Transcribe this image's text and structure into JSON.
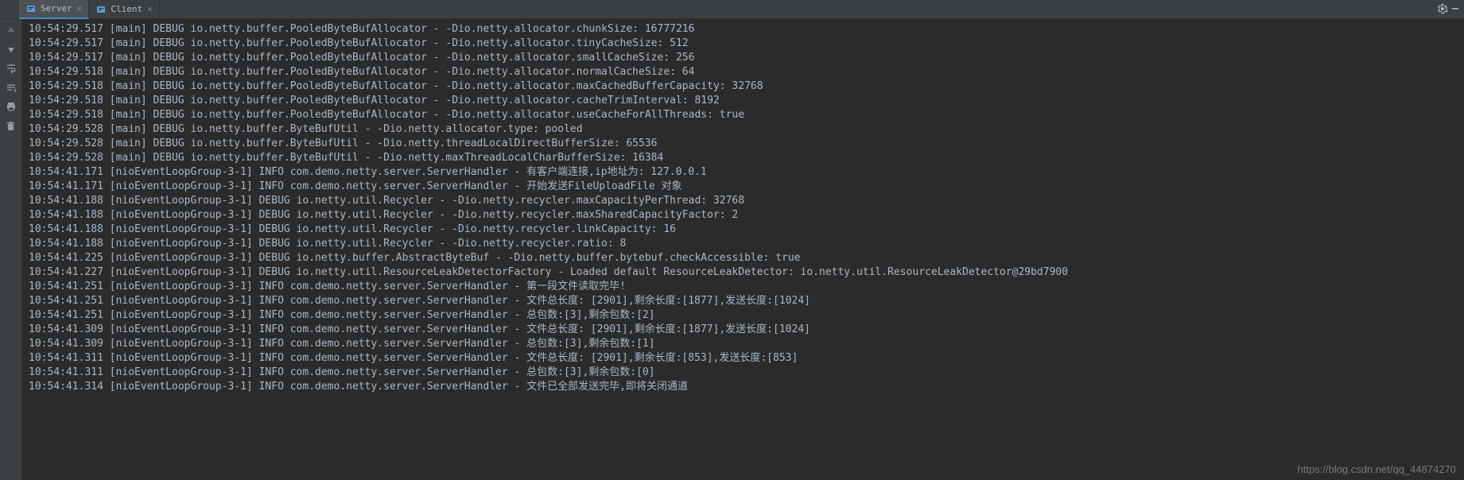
{
  "tabs": [
    {
      "label": "Server",
      "active": true
    },
    {
      "label": "Client",
      "active": false
    }
  ],
  "console_lines": [
    "10:54:29.517 [main] DEBUG io.netty.buffer.PooledByteBufAllocator - -Dio.netty.allocator.chunkSize: 16777216",
    "10:54:29.517 [main] DEBUG io.netty.buffer.PooledByteBufAllocator - -Dio.netty.allocator.tinyCacheSize: 512",
    "10:54:29.517 [main] DEBUG io.netty.buffer.PooledByteBufAllocator - -Dio.netty.allocator.smallCacheSize: 256",
    "10:54:29.518 [main] DEBUG io.netty.buffer.PooledByteBufAllocator - -Dio.netty.allocator.normalCacheSize: 64",
    "10:54:29.518 [main] DEBUG io.netty.buffer.PooledByteBufAllocator - -Dio.netty.allocator.maxCachedBufferCapacity: 32768",
    "10:54:29.518 [main] DEBUG io.netty.buffer.PooledByteBufAllocator - -Dio.netty.allocator.cacheTrimInterval: 8192",
    "10:54:29.518 [main] DEBUG io.netty.buffer.PooledByteBufAllocator - -Dio.netty.allocator.useCacheForAllThreads: true",
    "10:54:29.528 [main] DEBUG io.netty.buffer.ByteBufUtil - -Dio.netty.allocator.type: pooled",
    "10:54:29.528 [main] DEBUG io.netty.buffer.ByteBufUtil - -Dio.netty.threadLocalDirectBufferSize: 65536",
    "10:54:29.528 [main] DEBUG io.netty.buffer.ByteBufUtil - -Dio.netty.maxThreadLocalCharBufferSize: 16384",
    "10:54:41.171 [nioEventLoopGroup-3-1] INFO com.demo.netty.server.ServerHandler - 有客户端连接,ip地址为: 127.0.0.1",
    "10:54:41.171 [nioEventLoopGroup-3-1] INFO com.demo.netty.server.ServerHandler - 开始发送FileUploadFile 对象",
    "10:54:41.188 [nioEventLoopGroup-3-1] DEBUG io.netty.util.Recycler - -Dio.netty.recycler.maxCapacityPerThread: 32768",
    "10:54:41.188 [nioEventLoopGroup-3-1] DEBUG io.netty.util.Recycler - -Dio.netty.recycler.maxSharedCapacityFactor: 2",
    "10:54:41.188 [nioEventLoopGroup-3-1] DEBUG io.netty.util.Recycler - -Dio.netty.recycler.linkCapacity: 16",
    "10:54:41.188 [nioEventLoopGroup-3-1] DEBUG io.netty.util.Recycler - -Dio.netty.recycler.ratio: 8",
    "10:54:41.225 [nioEventLoopGroup-3-1] DEBUG io.netty.buffer.AbstractByteBuf - -Dio.netty.buffer.bytebuf.checkAccessible: true",
    "10:54:41.227 [nioEventLoopGroup-3-1] DEBUG io.netty.util.ResourceLeakDetectorFactory - Loaded default ResourceLeakDetector: io.netty.util.ResourceLeakDetector@29bd7900",
    "10:54:41.251 [nioEventLoopGroup-3-1] INFO com.demo.netty.server.ServerHandler - 第一段文件读取完毕!",
    "10:54:41.251 [nioEventLoopGroup-3-1] INFO com.demo.netty.server.ServerHandler - 文件总长度: [2901],剩余长度:[1877],发送长度:[1024]",
    "10:54:41.251 [nioEventLoopGroup-3-1] INFO com.demo.netty.server.ServerHandler - 总包数:[3],剩余包数:[2]",
    "10:54:41.309 [nioEventLoopGroup-3-1] INFO com.demo.netty.server.ServerHandler - 文件总长度: [2901],剩余长度:[1877],发送长度:[1024]",
    "10:54:41.309 [nioEventLoopGroup-3-1] INFO com.demo.netty.server.ServerHandler - 总包数:[3],剩余包数:[1]",
    "10:54:41.311 [nioEventLoopGroup-3-1] INFO com.demo.netty.server.ServerHandler - 文件总长度: [2901],剩余长度:[853],发送长度:[853]",
    "10:54:41.311 [nioEventLoopGroup-3-1] INFO com.demo.netty.server.ServerHandler - 总包数:[3],剩余包数:[0]",
    "10:54:41.314 [nioEventLoopGroup-3-1] INFO com.demo.netty.server.ServerHandler - 文件已全部发送完毕,即将关闭通道"
  ],
  "watermark": "https://blog.csdn.net/qq_44874270"
}
